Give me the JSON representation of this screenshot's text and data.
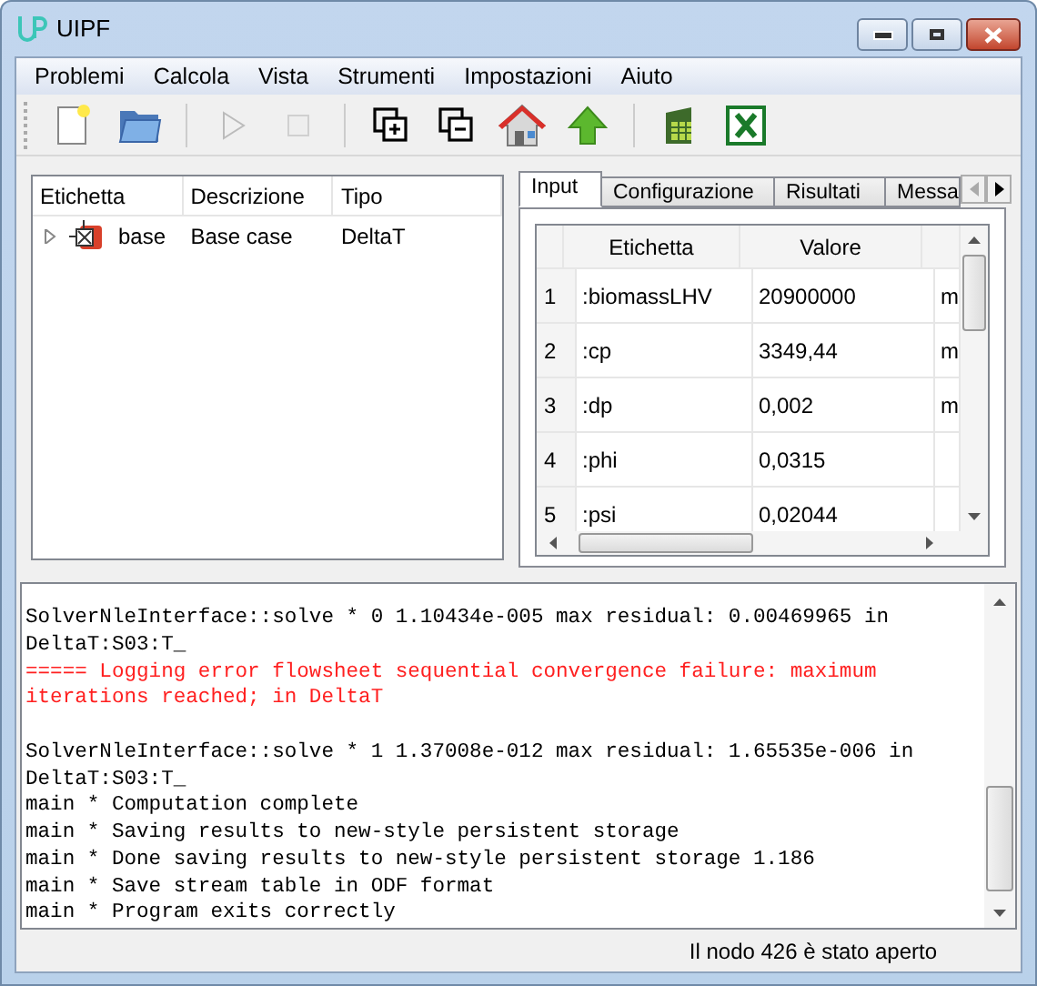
{
  "window": {
    "title": "UIPF"
  },
  "menu": [
    "Problemi",
    "Calcola",
    "Vista",
    "Strumenti",
    "Impostazioni",
    "Aiuto"
  ],
  "toolbar": [
    {
      "kind": "new",
      "disabled": false
    },
    {
      "kind": "open",
      "disabled": false
    },
    {
      "kind": "sep"
    },
    {
      "kind": "play",
      "disabled": true
    },
    {
      "kind": "stop",
      "disabled": true
    },
    {
      "kind": "sep"
    },
    {
      "kind": "add",
      "disabled": false
    },
    {
      "kind": "remove",
      "disabled": false
    },
    {
      "kind": "home",
      "disabled": false
    },
    {
      "kind": "up",
      "disabled": false
    },
    {
      "kind": "sep"
    },
    {
      "kind": "sheet",
      "disabled": false
    },
    {
      "kind": "excel",
      "disabled": false
    }
  ],
  "tree": {
    "columns": [
      "Etichetta",
      "Descrizione",
      "Tipo"
    ],
    "rows": [
      {
        "label": "base",
        "description": "Base case",
        "type": "DeltaT",
        "expanded": false
      }
    ]
  },
  "tabs": [
    {
      "label": "Input",
      "selected": true
    },
    {
      "label": "Configurazione",
      "selected": false
    },
    {
      "label": "Risultati",
      "selected": false
    },
    {
      "label": "Messa",
      "selected": false
    }
  ],
  "table": {
    "columns": [
      "Etichetta",
      "Valore"
    ],
    "rows": [
      {
        "index": "1",
        "label": ":biomassLHV",
        "value": "20900000",
        "column_3": "m"
      },
      {
        "index": "2",
        "label": ":cp",
        "value": "3349,44",
        "column_3": "m"
      },
      {
        "index": "3",
        "label": ":dp",
        "value": "0,002",
        "column_3": "m"
      },
      {
        "index": "4",
        "label": ":phi",
        "value": "0,0315"
      },
      {
        "index": "5",
        "label": ":psi",
        "value": "0,02044"
      }
    ]
  },
  "log": [
    {
      "kind": "info",
      "lines": [
        "SolverNleInterface::solve * 0 1.10434e-005 max residual: 0.00469965 in",
        "DeltaT:S03:T_"
      ]
    },
    {
      "kind": "error",
      "lines": [
        "===== Logging error flowsheet sequential convergence failure: maximum",
        "iterations reached; in DeltaT"
      ]
    },
    {
      "kind": "blank"
    },
    {
      "kind": "info",
      "lines": [
        "SolverNleInterface::solve * 1 1.37008e-012 max residual: 1.65535e-006 in",
        "DeltaT:S03:T_"
      ]
    },
    {
      "kind": "info",
      "lines": [
        "main * Computation complete"
      ]
    },
    {
      "kind": "info",
      "lines": [
        "main * Saving results to new-style persistent storage"
      ]
    },
    {
      "kind": "info",
      "lines": [
        "main * Done saving results to new-style persistent storage 1.186"
      ]
    },
    {
      "kind": "info",
      "lines": [
        "main * Save stream table in ODF format"
      ]
    },
    {
      "kind": "info",
      "lines": [
        "main * Program exits correctly"
      ]
    }
  ],
  "status_bar": "Il nodo 426 è stato aperto"
}
